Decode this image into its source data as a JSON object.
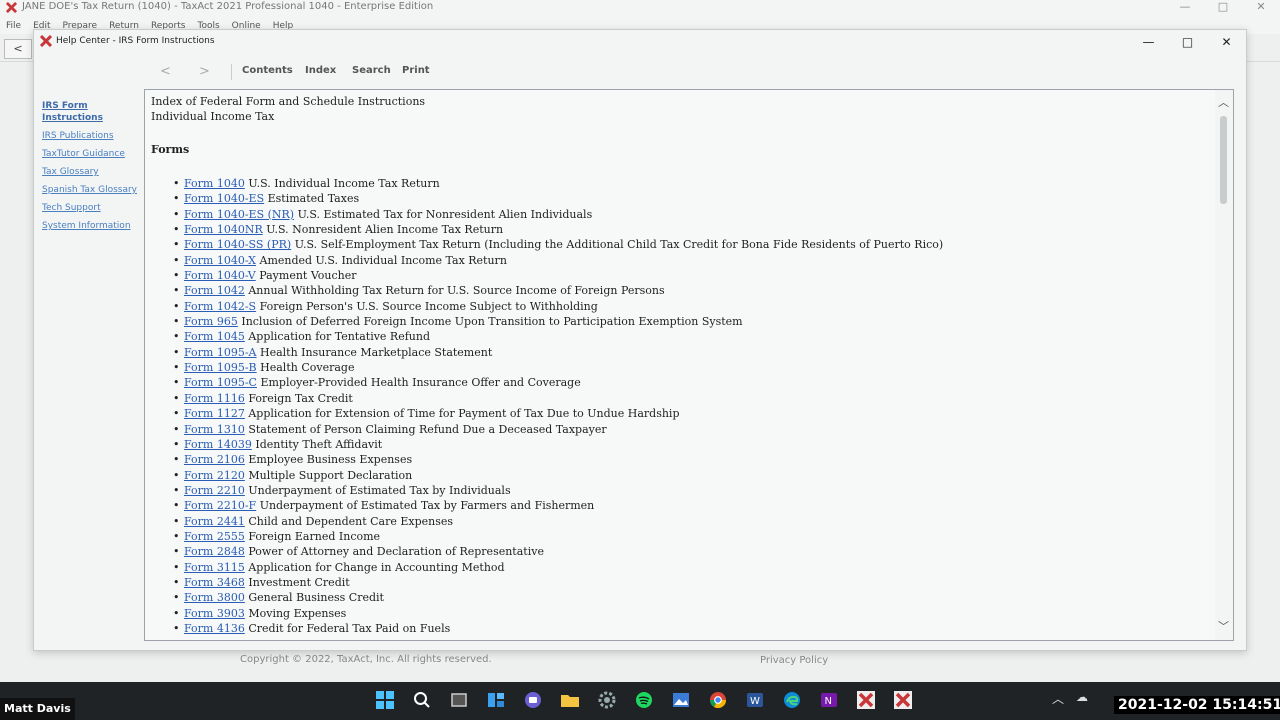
{
  "background_app": {
    "title": "JANE DOE's Tax Return (1040) - TaxAct 2021 Professional 1040 - Enterprise Edition",
    "menu": [
      "File",
      "Edit",
      "Prepare",
      "Return",
      "Reports",
      "Tools",
      "Online",
      "Help"
    ],
    "copyright": "Copyright © 2022, TaxAct, Inc. All rights reserved.",
    "privacy": "Privacy Policy"
  },
  "help_window": {
    "title": "Help Center - IRS Form Instructions",
    "toolbar": {
      "back": "<",
      "forward": ">",
      "contents": "Contents",
      "index": "Index",
      "search": "Search",
      "print": "Print"
    },
    "sidebar": [
      {
        "label": "IRS Form Instructions",
        "active": true
      },
      {
        "label": "IRS Publications",
        "active": false
      },
      {
        "label": "TaxTutor Guidance",
        "active": false
      },
      {
        "label": "Tax Glossary",
        "active": false
      },
      {
        "label": "Spanish Tax Glossary",
        "active": false
      },
      {
        "label": "Tech Support",
        "active": false
      },
      {
        "label": "System Information",
        "active": false
      }
    ],
    "content": {
      "heading1": "Index of Federal Form and Schedule Instructions",
      "heading2": "Individual Income Tax",
      "section": "Forms",
      "forms": [
        {
          "link": "Form 1040",
          "desc": "U.S. Individual Income Tax Return"
        },
        {
          "link": "Form 1040-ES",
          "desc": "Estimated Taxes"
        },
        {
          "link": "Form 1040-ES (NR)",
          "desc": "U.S. Estimated Tax for Nonresident Alien Individuals"
        },
        {
          "link": "Form 1040NR",
          "desc": "U.S. Nonresident Alien Income Tax Return"
        },
        {
          "link": "Form 1040-SS (PR)",
          "desc": "U.S. Self-Employment Tax Return (Including the Additional Child Tax Credit for Bona Fide Residents of Puerto Rico)"
        },
        {
          "link": "Form 1040-X",
          "desc": "Amended U.S. Individual Income Tax Return"
        },
        {
          "link": "Form 1040-V",
          "desc": "Payment Voucher"
        },
        {
          "link": "Form 1042",
          "desc": "Annual Withholding Tax Return for U.S. Source Income of Foreign Persons"
        },
        {
          "link": "Form 1042-S",
          "desc": "Foreign Person's U.S. Source Income Subject to Withholding"
        },
        {
          "link": "Form 965",
          "desc": "Inclusion of Deferred Foreign Income Upon Transition to Participation Exemption System"
        },
        {
          "link": "Form 1045",
          "desc": "Application for Tentative Refund"
        },
        {
          "link": "Form 1095-A",
          "desc": "Health Insurance Marketplace Statement"
        },
        {
          "link": "Form 1095-B",
          "desc": "Health Coverage"
        },
        {
          "link": "Form 1095-C",
          "desc": "Employer-Provided Health Insurance Offer and Coverage"
        },
        {
          "link": "Form 1116",
          "desc": "Foreign Tax Credit"
        },
        {
          "link": "Form 1127",
          "desc": "Application for Extension of Time for Payment of Tax Due to Undue Hardship"
        },
        {
          "link": "Form 1310",
          "desc": "Statement of Person Claiming Refund Due a Deceased Taxpayer"
        },
        {
          "link": "Form 14039",
          "desc": "Identity Theft Affidavit"
        },
        {
          "link": "Form 2106",
          "desc": "Employee Business Expenses"
        },
        {
          "link": "Form 2120",
          "desc": "Multiple Support Declaration"
        },
        {
          "link": "Form 2210",
          "desc": "Underpayment of Estimated Tax by Individuals"
        },
        {
          "link": "Form 2210-F",
          "desc": "Underpayment of Estimated Tax by Farmers and Fishermen"
        },
        {
          "link": "Form 2441",
          "desc": "Child and Dependent Care Expenses"
        },
        {
          "link": "Form 2555",
          "desc": "Foreign Earned Income"
        },
        {
          "link": "Form 2848",
          "desc": "Power of Attorney and Declaration of Representative"
        },
        {
          "link": "Form 3115",
          "desc": "Application for Change in Accounting Method"
        },
        {
          "link": "Form 3468",
          "desc": "Investment Credit"
        },
        {
          "link": "Form 3800",
          "desc": "General Business Credit"
        },
        {
          "link": "Form 3903",
          "desc": "Moving Expenses"
        },
        {
          "link": "Form 4136",
          "desc": "Credit for Federal Tax Paid on Fuels"
        }
      ]
    }
  },
  "taskbar": {
    "user": "Matt Davis",
    "clock": "2021-12-02  15:14:51",
    "icons": [
      "windows-start-icon",
      "search-icon",
      "task-view-icon",
      "widgets-icon",
      "chat-icon",
      "file-explorer-icon",
      "settings-icon",
      "spotify-icon",
      "word-doc-icon",
      "chrome-icon",
      "word-icon",
      "edge-icon",
      "onenote-icon",
      "taxact-icon",
      "taxact-help-icon"
    ]
  },
  "colors": {
    "link": "#2a5db5",
    "sidebar_link": "#4a7fc0",
    "taskbar": "#1f2326"
  }
}
